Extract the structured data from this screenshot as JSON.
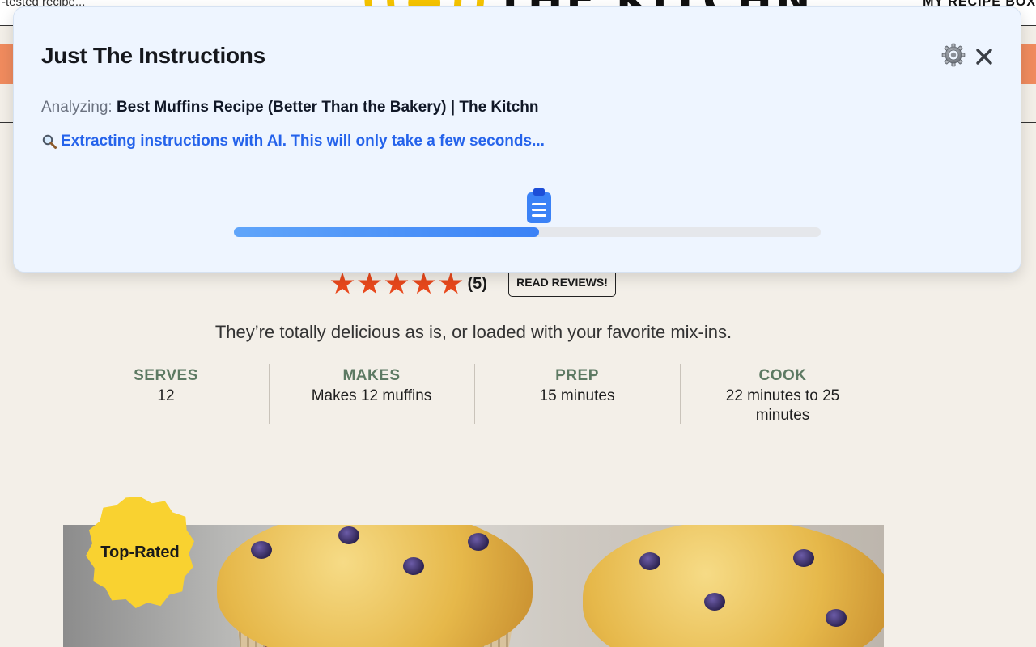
{
  "site": {
    "search_snippet": "-tested recipe...",
    "logo_text": "THE KITCHN",
    "recipe_box_label": "MY RECIPE BOX"
  },
  "recipe": {
    "rating_count": "(5)",
    "read_reviews_label": "READ REVIEWS!",
    "tagline": "They’re totally delicious as is, or loaded with your favorite mix-ins.",
    "stats": [
      {
        "label": "SERVES",
        "value": "12"
      },
      {
        "label": "MAKES",
        "value": "Makes 12 muffins"
      },
      {
        "label": "PREP",
        "value": "15 minutes"
      },
      {
        "label": "COOK",
        "value": "22 minutes to 25 minutes"
      }
    ],
    "badge_label": "Top-Rated",
    "stars": 5
  },
  "extension": {
    "title": "Just The Instructions",
    "settings_icon": "gear-icon",
    "close_icon": "close-icon",
    "analyzing_prefix": "Analyzing:",
    "page_title": "Best Muffins Recipe (Better Than the Bakery) | The Kitchn",
    "status_icon": "magnifier-icon",
    "status_text": "Extracting instructions with AI. This will only take a few seconds...",
    "progress_percent": 52,
    "colors": {
      "panel_bg": "#eef5ff",
      "accent": "#2563eb",
      "progress": "#3b82f6"
    }
  }
}
